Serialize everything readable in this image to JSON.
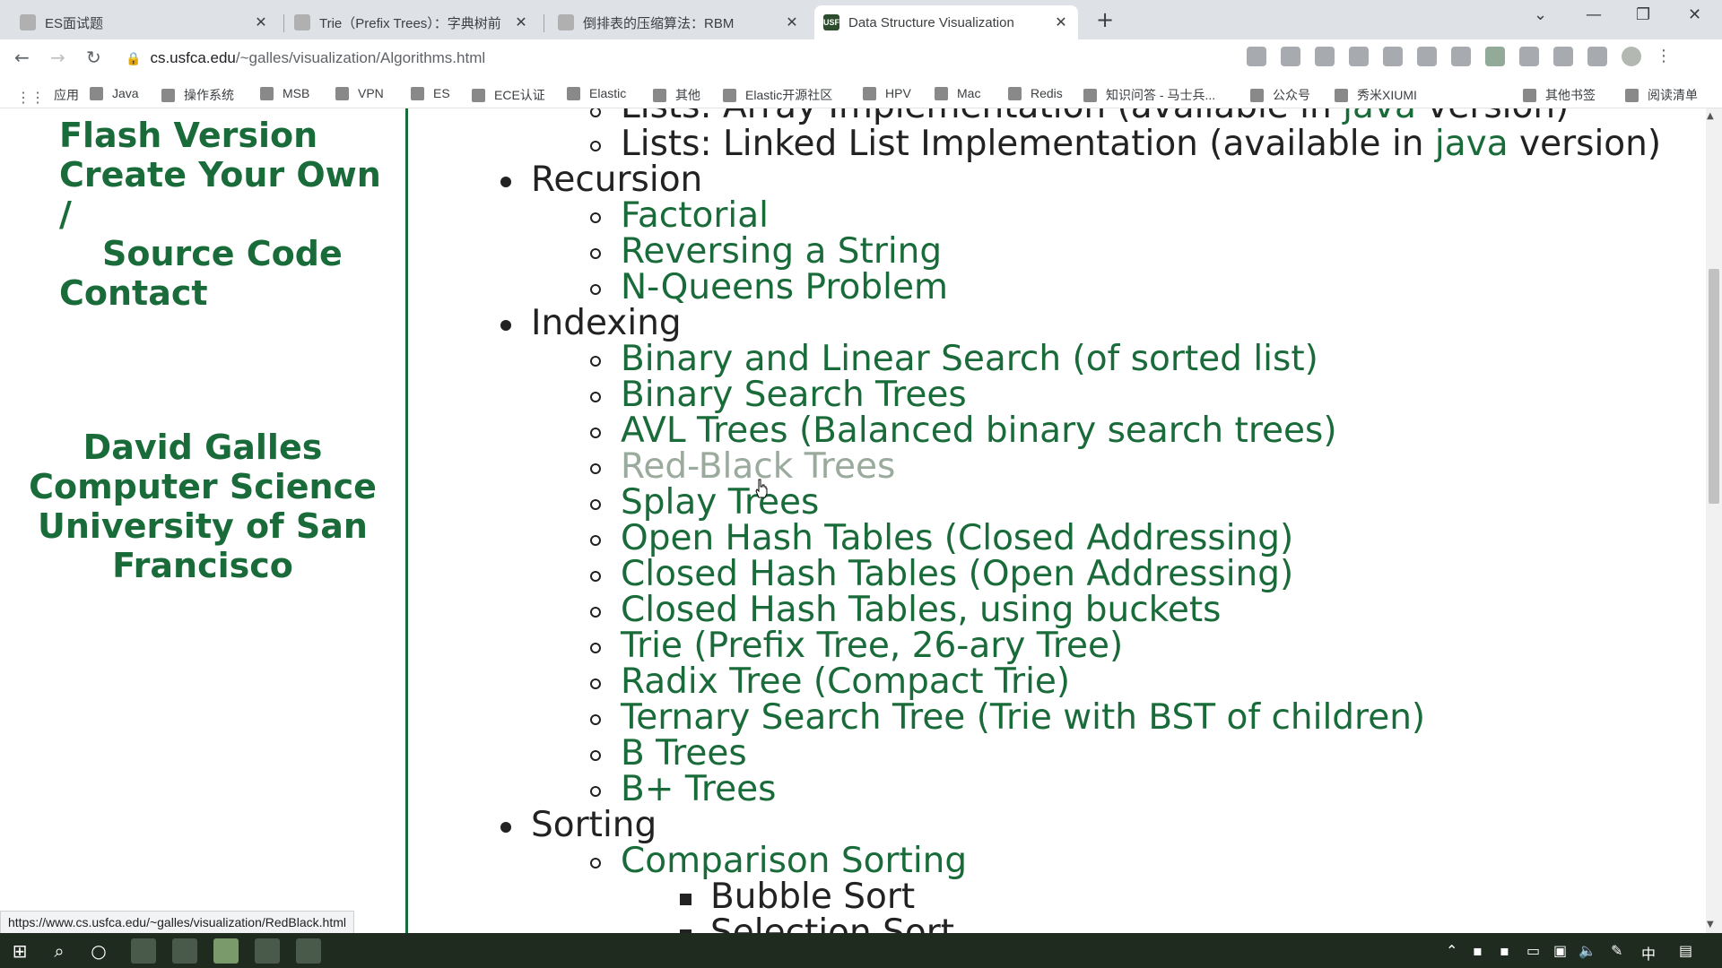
{
  "browser": {
    "tabs": [
      {
        "title": "ES面试题",
        "active": false
      },
      {
        "title": "Trie（Prefix Trees）：字典树前",
        "active": false
      },
      {
        "title": "倒排表的压缩算法：RBM",
        "active": false
      },
      {
        "title": "Data Structure Visualization",
        "active": true,
        "favicon_text": "USF"
      }
    ],
    "new_tab": "+",
    "window_controls": {
      "chevron": "⌄",
      "minimize": "—",
      "restore": "❐",
      "close": "✕"
    },
    "url_host": "cs.usfca.edu",
    "url_path": "/~galles/visualization/Algorithms.html",
    "bookmarks": [
      "应用",
      "Java",
      "操作系统",
      "MSB",
      "VPN",
      "ES",
      "ECE认证",
      "Elastic",
      "其他",
      "Elastic开源社区",
      "HPV",
      "Mac",
      "Redis",
      "知识问答 - 马士兵...",
      "公众号",
      "秀米XIUMI"
    ],
    "bookmarks_right": [
      "其他书签",
      "阅读清单"
    ]
  },
  "sidebar": {
    "links": [
      "Flash Version",
      "Create Your Own",
      "/",
      "Source Code",
      "Contact"
    ],
    "author": [
      "David Galles",
      "Computer Science",
      "University of San",
      "Francisco"
    ]
  },
  "content": {
    "partial_top": {
      "text": "Lists: Array Implementation (available in ",
      "link": "java",
      "suffix": " version)"
    },
    "linked_list": {
      "text": "Lists: Linked List Implementation (available in ",
      "link": "java",
      "suffix": " version)"
    },
    "recursion": {
      "heading": "Recursion",
      "items": [
        "Factorial",
        "Reversing a String",
        "N-Queens Problem"
      ]
    },
    "indexing": {
      "heading": "Indexing",
      "items": [
        "Binary and Linear Search (of sorted list)",
        "Binary Search Trees",
        "AVL Trees (Balanced binary search trees)",
        "Red-Black Trees",
        "Splay Trees",
        "Open Hash Tables (Closed Addressing)",
        "Closed Hash Tables (Open Addressing)",
        "Closed Hash Tables, using buckets",
        "Trie (Prefix Tree, 26-ary Tree)",
        "Radix Tree (Compact Trie)",
        "Ternary Search Tree (Trie with BST of children)",
        "B Trees",
        "B+ Trees"
      ]
    },
    "sorting": {
      "heading": "Sorting",
      "comparison": "Comparison Sorting",
      "items": [
        "Bubble Sort",
        "Selection Sort"
      ]
    }
  },
  "status_url": "https://www.cs.usfca.edu/~galles/visualization/RedBlack.html",
  "colors": {
    "link": "#1a6b3a",
    "hover_link": "#9aaa9c",
    "text": "#222222"
  },
  "taskbar": {
    "ime": "中"
  }
}
